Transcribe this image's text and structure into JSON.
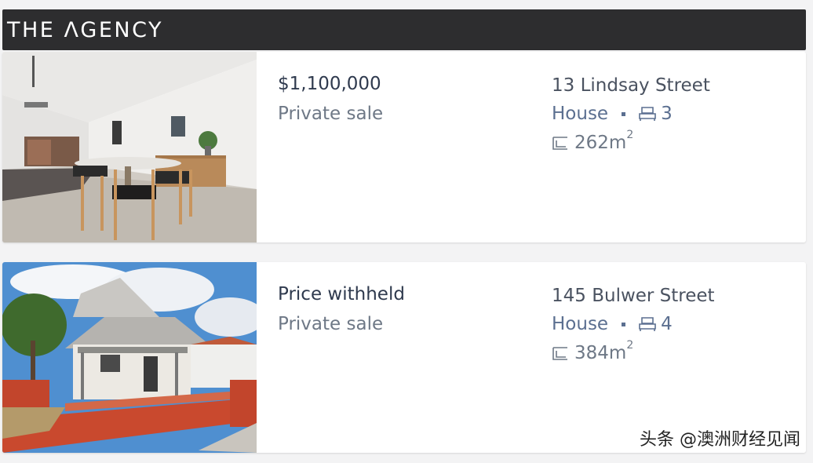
{
  "header": {
    "brand": "THE ΛGENCY"
  },
  "listings": [
    {
      "price": "$1,100,000",
      "sale_type": "Private sale",
      "address": "13 Lindsay Street",
      "property_type": "House",
      "bedrooms": "3",
      "land_area": "262m",
      "land_area_unit_sup": "2",
      "photo_icon": "interior-photo"
    },
    {
      "price": "Price withheld",
      "sale_type": "Private sale",
      "address": "145 Bulwer Street",
      "property_type": "House",
      "bedrooms": "4",
      "land_area": "384m",
      "land_area_unit_sup": "2",
      "photo_icon": "house-exterior-photo"
    }
  ],
  "watermark": "头条 @澳洲财经见闻",
  "colors": {
    "header_bg": "#2d2d2f",
    "price_text": "#2f3a4e",
    "accent": "#5b6f90"
  }
}
